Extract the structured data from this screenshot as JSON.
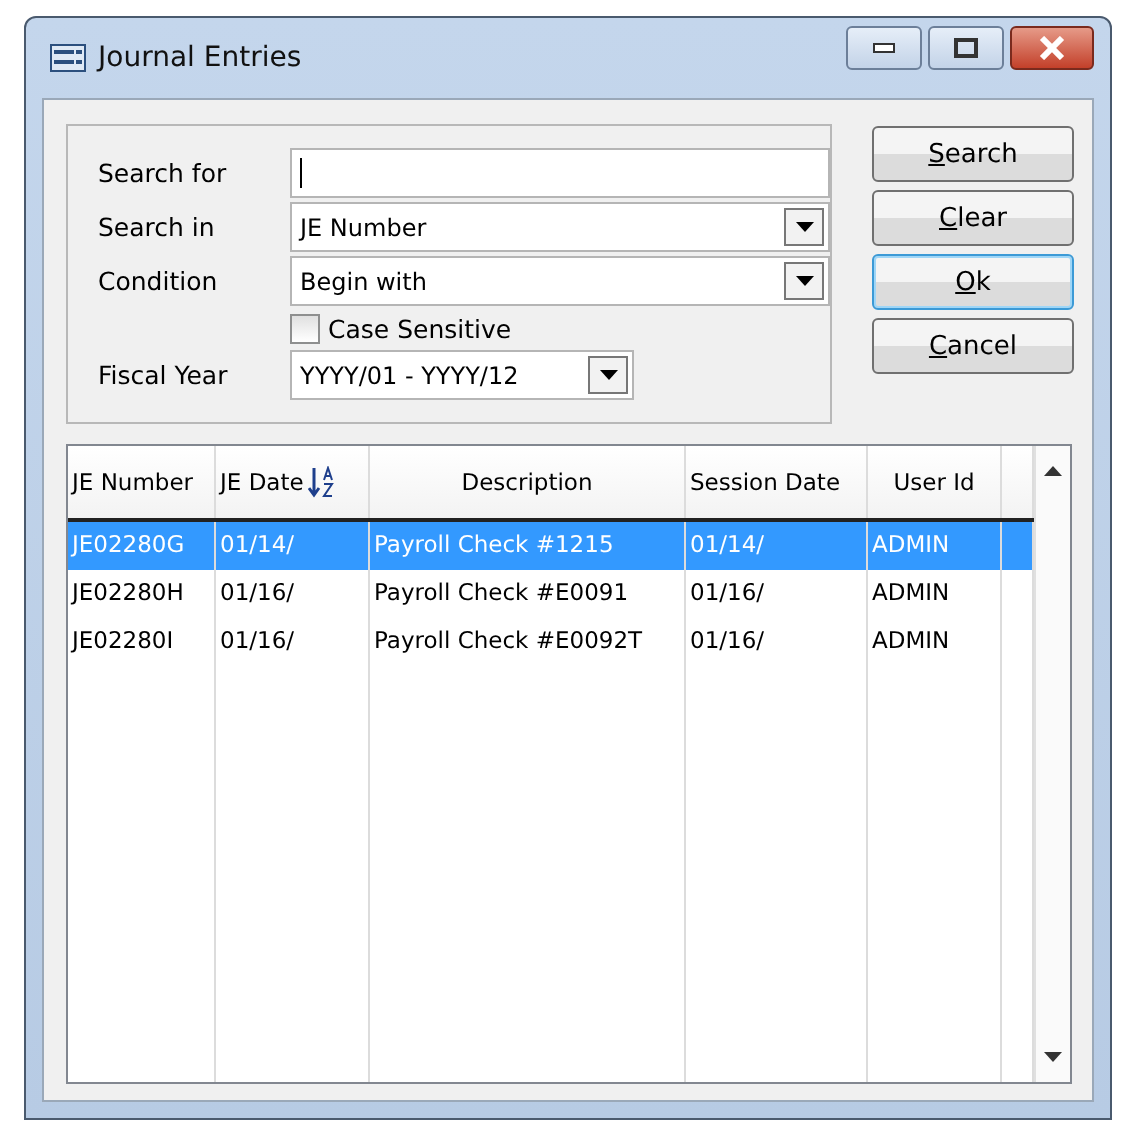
{
  "window": {
    "title": "Journal Entries"
  },
  "filter": {
    "search_for": {
      "label": "Search for"
    },
    "search_in": {
      "label": "Search in",
      "value": "JE Number"
    },
    "condition": {
      "label": "Condition",
      "value": "Begin with"
    },
    "case_sensitive": {
      "label": "Case Sensitive",
      "checked": false
    },
    "fiscal_year": {
      "label": "Fiscal Year",
      "value": "YYYY/01 - YYYY/12"
    }
  },
  "buttons": [
    {
      "label": "Search",
      "default": false
    },
    {
      "label": "Clear",
      "default": false
    },
    {
      "label": "Ok",
      "default": true
    },
    {
      "label": "Cancel",
      "default": false
    }
  ],
  "table": {
    "columns": [
      {
        "label": "JE Number",
        "sorted": false
      },
      {
        "label": "JE Date",
        "sorted": true
      },
      {
        "label": "Description",
        "sorted": false
      },
      {
        "label": "Session Date",
        "sorted": false
      },
      {
        "label": "User Id",
        "sorted": false
      }
    ],
    "rows": [
      {
        "cells": [
          "JE02280G",
          "01/14/",
          "Payroll Check #1215",
          "01/14/",
          "ADMIN"
        ],
        "selected": true
      },
      {
        "cells": [
          "JE02280H",
          "01/16/",
          "Payroll Check #E0091",
          "01/16/",
          "ADMIN"
        ],
        "selected": false
      },
      {
        "cells": [
          "JE02280I",
          "01/16/",
          "Payroll Check #E0092T",
          "01/16/",
          "ADMIN"
        ],
        "selected": false
      }
    ]
  }
}
